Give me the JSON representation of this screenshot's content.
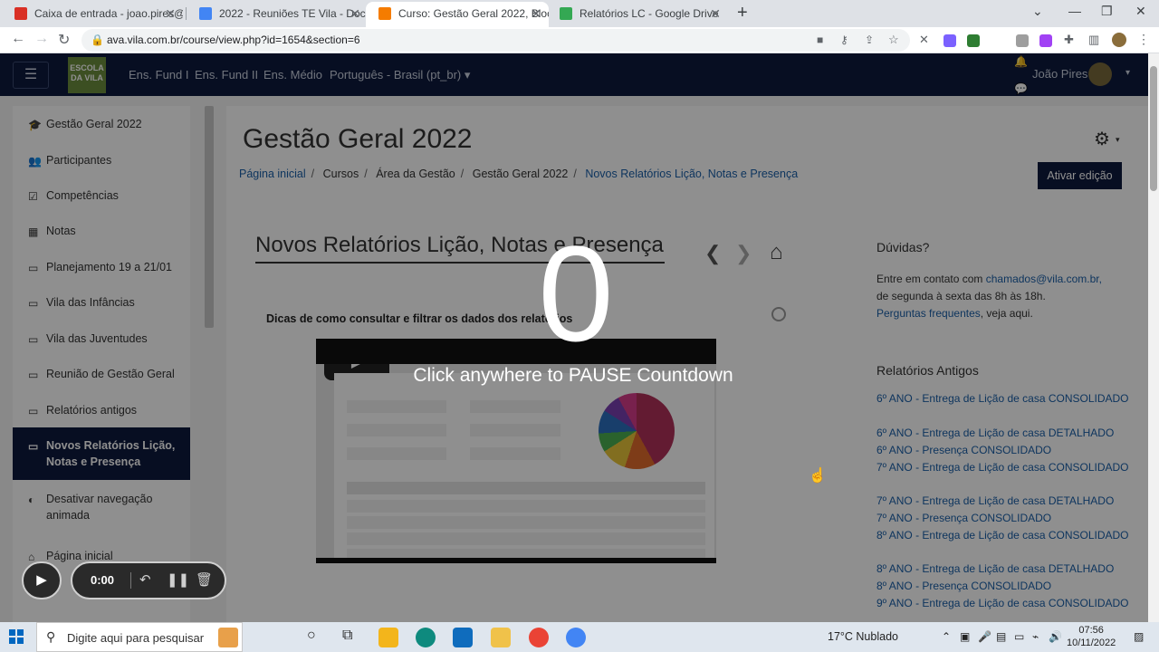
{
  "browser": {
    "tabs": [
      {
        "title": "Caixa de entrada - joao.pires@vi",
        "favicon_color": "#d93025"
      },
      {
        "title": "2022 - Reuniões TE Vila - Docum",
        "favicon_color": "#4285f4"
      },
      {
        "title": "Curso: Gestão Geral 2022, Bloco",
        "favicon_color": "#f57c00"
      },
      {
        "title": "Relatórios LC - Google Drive",
        "favicon_color": "#34a853"
      }
    ],
    "url": "ava.vila.com.br/course/view.php?id=1654&section=6"
  },
  "navbar": {
    "logo_text": "ESCOLA DA VILA",
    "links": [
      "Ens. Fund I",
      "Ens. Fund II",
      "Ens. Médio",
      "Português - Brasil (pt_br) ▾"
    ],
    "user_name": "João Pires"
  },
  "sidebar": {
    "items": [
      {
        "label": "Gestão Geral 2022",
        "icon": "graduation-cap"
      },
      {
        "label": "Participantes",
        "icon": "users"
      },
      {
        "label": "Competências",
        "icon": "checkbox"
      },
      {
        "label": "Notas",
        "icon": "table"
      },
      {
        "label": "Planejamento 19 a 21/01",
        "icon": "folder"
      },
      {
        "label": "Vila das Infâncias",
        "icon": "folder"
      },
      {
        "label": "Vila das Juventudes",
        "icon": "folder"
      },
      {
        "label": "Reunião de Gestão Geral",
        "icon": "folder"
      },
      {
        "label": "Relatórios antigos",
        "icon": "folder"
      },
      {
        "label": "Novos Relatórios Lição, Notas e Presença",
        "icon": "folder"
      },
      {
        "label": "Desativar navegação animada",
        "icon": "toggle"
      },
      {
        "label": "Página inicial",
        "icon": "home"
      }
    ]
  },
  "main": {
    "course_title": "Gestão Geral 2022",
    "breadcrumb": [
      "Página inicial",
      "Cursos",
      "Área da Gestão",
      "Gestão Geral 2022",
      "Novos Relatórios Lição, Notas e Presença"
    ],
    "edit_button": "Ativar edição",
    "section_title": "Novos Relatórios Lição, Notas e Presença",
    "tips": "Dicas de como consultar e filtrar os dados dos relatórios"
  },
  "blocks": {
    "duvidas": {
      "title": "Dúvidas?",
      "line1": "Entre em contato com",
      "email": "chamados@vila.com.br,",
      "line2": "de segunda à sexta das 8h às 18h.",
      "faq": "Perguntas frequentes",
      "line3": ", veja aqui."
    },
    "relatorios_antigos": {
      "title": "Relatórios Antigos",
      "links": [
        "6º ANO - Entrega de Lição de casa CONSOLIDADO",
        "6º ANO - Entrega de Lição de casa DETALHADO",
        "6º ANO - Presença CONSOLIDADO",
        "7º ANO - Entrega de Lição de casa CONSOLIDADO",
        "7º ANO - Entrega de Lição de casa DETALHADO",
        "7º ANO - Presença CONSOLIDADO",
        "8º ANO - Entrega de Lição de casa CONSOLIDADO",
        "8º ANO - Entrega de Lição de casa DETALHADO",
        "8º ANO - Presença CONSOLIDADO",
        "9º ANO - Entrega de Lição de casa CONSOLIDADO"
      ]
    }
  },
  "overlay": {
    "countdown": "0",
    "message": "Click anywhere to PAUSE Countdown"
  },
  "recorder": {
    "time": "0:00"
  },
  "taskbar": {
    "search_placeholder": "Digite aqui para pesquisar",
    "weather": "17°C  Nublado",
    "time": "07:56",
    "date": "10/11/2022"
  }
}
